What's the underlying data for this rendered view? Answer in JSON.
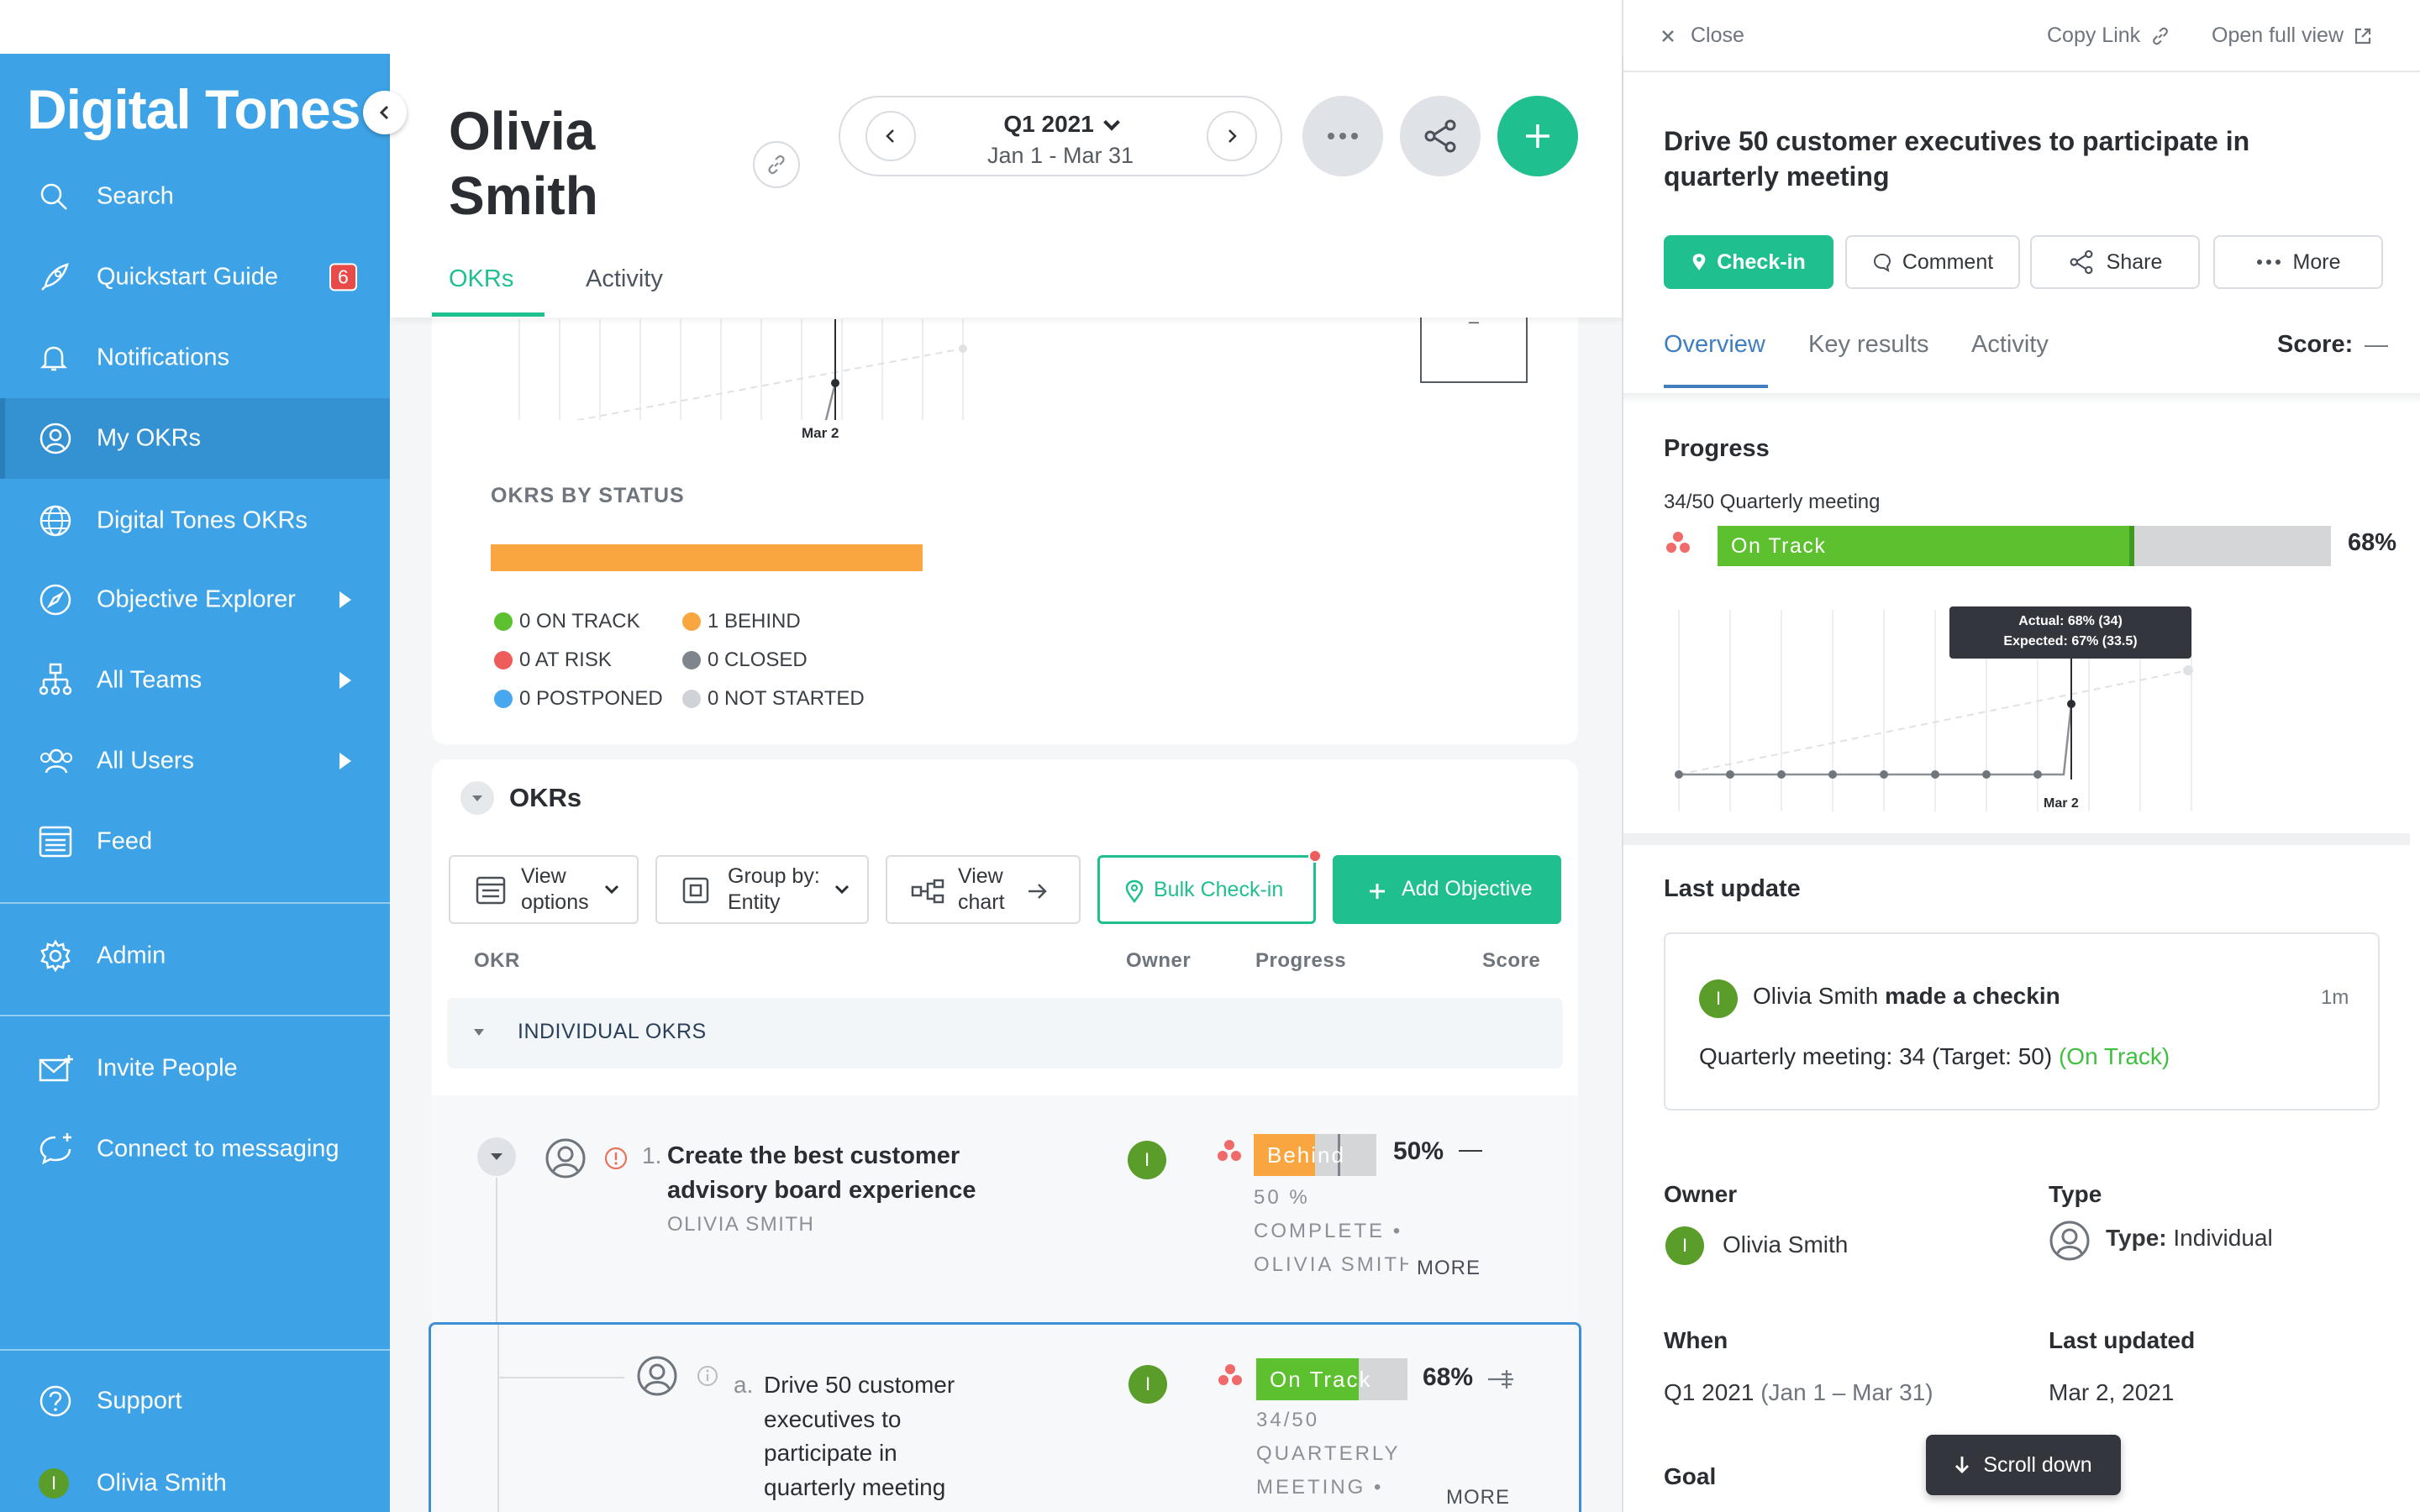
{
  "sidebar": {
    "brand": "Digital Tones",
    "items": [
      {
        "label": "Search",
        "icon": "search-icon"
      },
      {
        "label": "Quickstart Guide",
        "icon": "rocket-icon",
        "badge": "6"
      },
      {
        "label": "Notifications",
        "icon": "bell-icon"
      },
      {
        "label": "My OKRs",
        "icon": "target-icon",
        "active": true
      },
      {
        "label": "Digital Tones OKRs",
        "icon": "globe-icon"
      },
      {
        "label": "Objective Explorer",
        "icon": "compass-icon"
      },
      {
        "label": "All Teams",
        "icon": "org-chart-icon"
      },
      {
        "label": "All Users",
        "icon": "users-icon"
      },
      {
        "label": "Feed",
        "icon": "feed-icon"
      },
      {
        "label": "Admin",
        "icon": "gear-icon"
      },
      {
        "label": "Invite People",
        "icon": "invite-icon"
      },
      {
        "label": "Connect to messaging",
        "icon": "messaging-icon"
      },
      {
        "label": "Support",
        "icon": "help-icon"
      },
      {
        "label": "Olivia Smith",
        "icon": "user-avatar",
        "avatar_letter": "I"
      }
    ]
  },
  "header": {
    "name": "Olivia Smith",
    "period": {
      "title": "Q1 2021",
      "range": "Jan 1 - Mar 31"
    },
    "tabs": [
      "OKRs",
      "Activity"
    ]
  },
  "summary": {
    "chart_date": "Mar 2",
    "status_title": "OKRS BY STATUS",
    "status_bar_color": "#f9a540",
    "legend": [
      {
        "label": "0 ON TRACK",
        "color": "#5cc02f"
      },
      {
        "label": "1 BEHIND",
        "color": "#f9a540"
      },
      {
        "label": "0 AT RISK",
        "color": "#ee5c5c"
      },
      {
        "label": "0 CLOSED",
        "color": "#7e858c"
      },
      {
        "label": "0 POSTPONED",
        "color": "#48a7ee"
      },
      {
        "label": "0 NOT STARTED",
        "color": "#cfd3d7"
      }
    ],
    "box_value": "–"
  },
  "okrs": {
    "title": "OKRs",
    "toolbar": {
      "view_options": "View options",
      "group_by": "Group by: Entity",
      "view_chart": "View chart",
      "bulk_checkin": "Bulk Check-in",
      "add_objective": "Add Objective"
    },
    "columns": {
      "okr": "OKR",
      "owner": "Owner",
      "progress": "Progress",
      "score": "Score"
    },
    "group": "INDIVIDUAL OKRS",
    "rows": [
      {
        "index": "1.",
        "title": "Create the best customer advisory board experience",
        "owner": "OLIVIA SMITH",
        "avatar_letter": "I",
        "status": "Behind",
        "percent": "50%",
        "score": "—",
        "meta1": "50 %",
        "meta2": "COMPLETE •",
        "meta3": "OLIVIA SMITH",
        "more": "MORE",
        "progress": 0.5
      },
      {
        "index": "a.",
        "title": "Drive 50 customer executives to participate in quarterly meeting",
        "avatar_letter": "I",
        "status": "On Track",
        "percent": "68%",
        "meta1": "34/50",
        "meta2": "QUARTERLY",
        "meta3": "MEETING •",
        "more": "MORE",
        "progress": 0.68
      }
    ]
  },
  "panel": {
    "close": "Close",
    "copy_link": "Copy Link",
    "open_full": "Open full view",
    "title": "Drive 50 customer executives to participate in quarterly meeting",
    "actions": {
      "checkin": "Check-in",
      "comment": "Comment",
      "share": "Share",
      "more": "More"
    },
    "tabs": [
      "Overview",
      "Key results",
      "Activity"
    ],
    "score_label": "Score:",
    "score_value": "—",
    "progress_title": "Progress",
    "progress_label": "34/50 Quarterly meeting",
    "status": "On Track",
    "percent": "68%",
    "progress_value": 0.68,
    "tooltip_actual": "Actual: 68% (34)",
    "tooltip_expected": "Expected: 67% (33.5)",
    "chart_date": "Mar 2",
    "last_update_title": "Last update",
    "update": {
      "avatar_letter": "I",
      "name": "Olivia Smith",
      "action": "made a checkin",
      "time": "1m",
      "metric": "Quarterly meeting: 34 (Target: 50)",
      "status": "(On Track)"
    },
    "owner_label": "Owner",
    "owner_name": "Olivia Smith",
    "type_label": "Type",
    "type_prefix": "Type:",
    "type_value": "Individual",
    "when_label": "When",
    "when_period": "Q1 2021",
    "when_range": "(Jan 1 – Mar 31)",
    "last_updated_label": "Last updated",
    "last_updated_value": "Mar 2, 2021",
    "goal_label": "Goal",
    "scroll_down": "Scroll down"
  },
  "colors": {
    "sidebar": "#3da3e6",
    "accent_green": "#1fbf8f",
    "on_track": "#5cc02f",
    "behind": "#f9a540"
  }
}
